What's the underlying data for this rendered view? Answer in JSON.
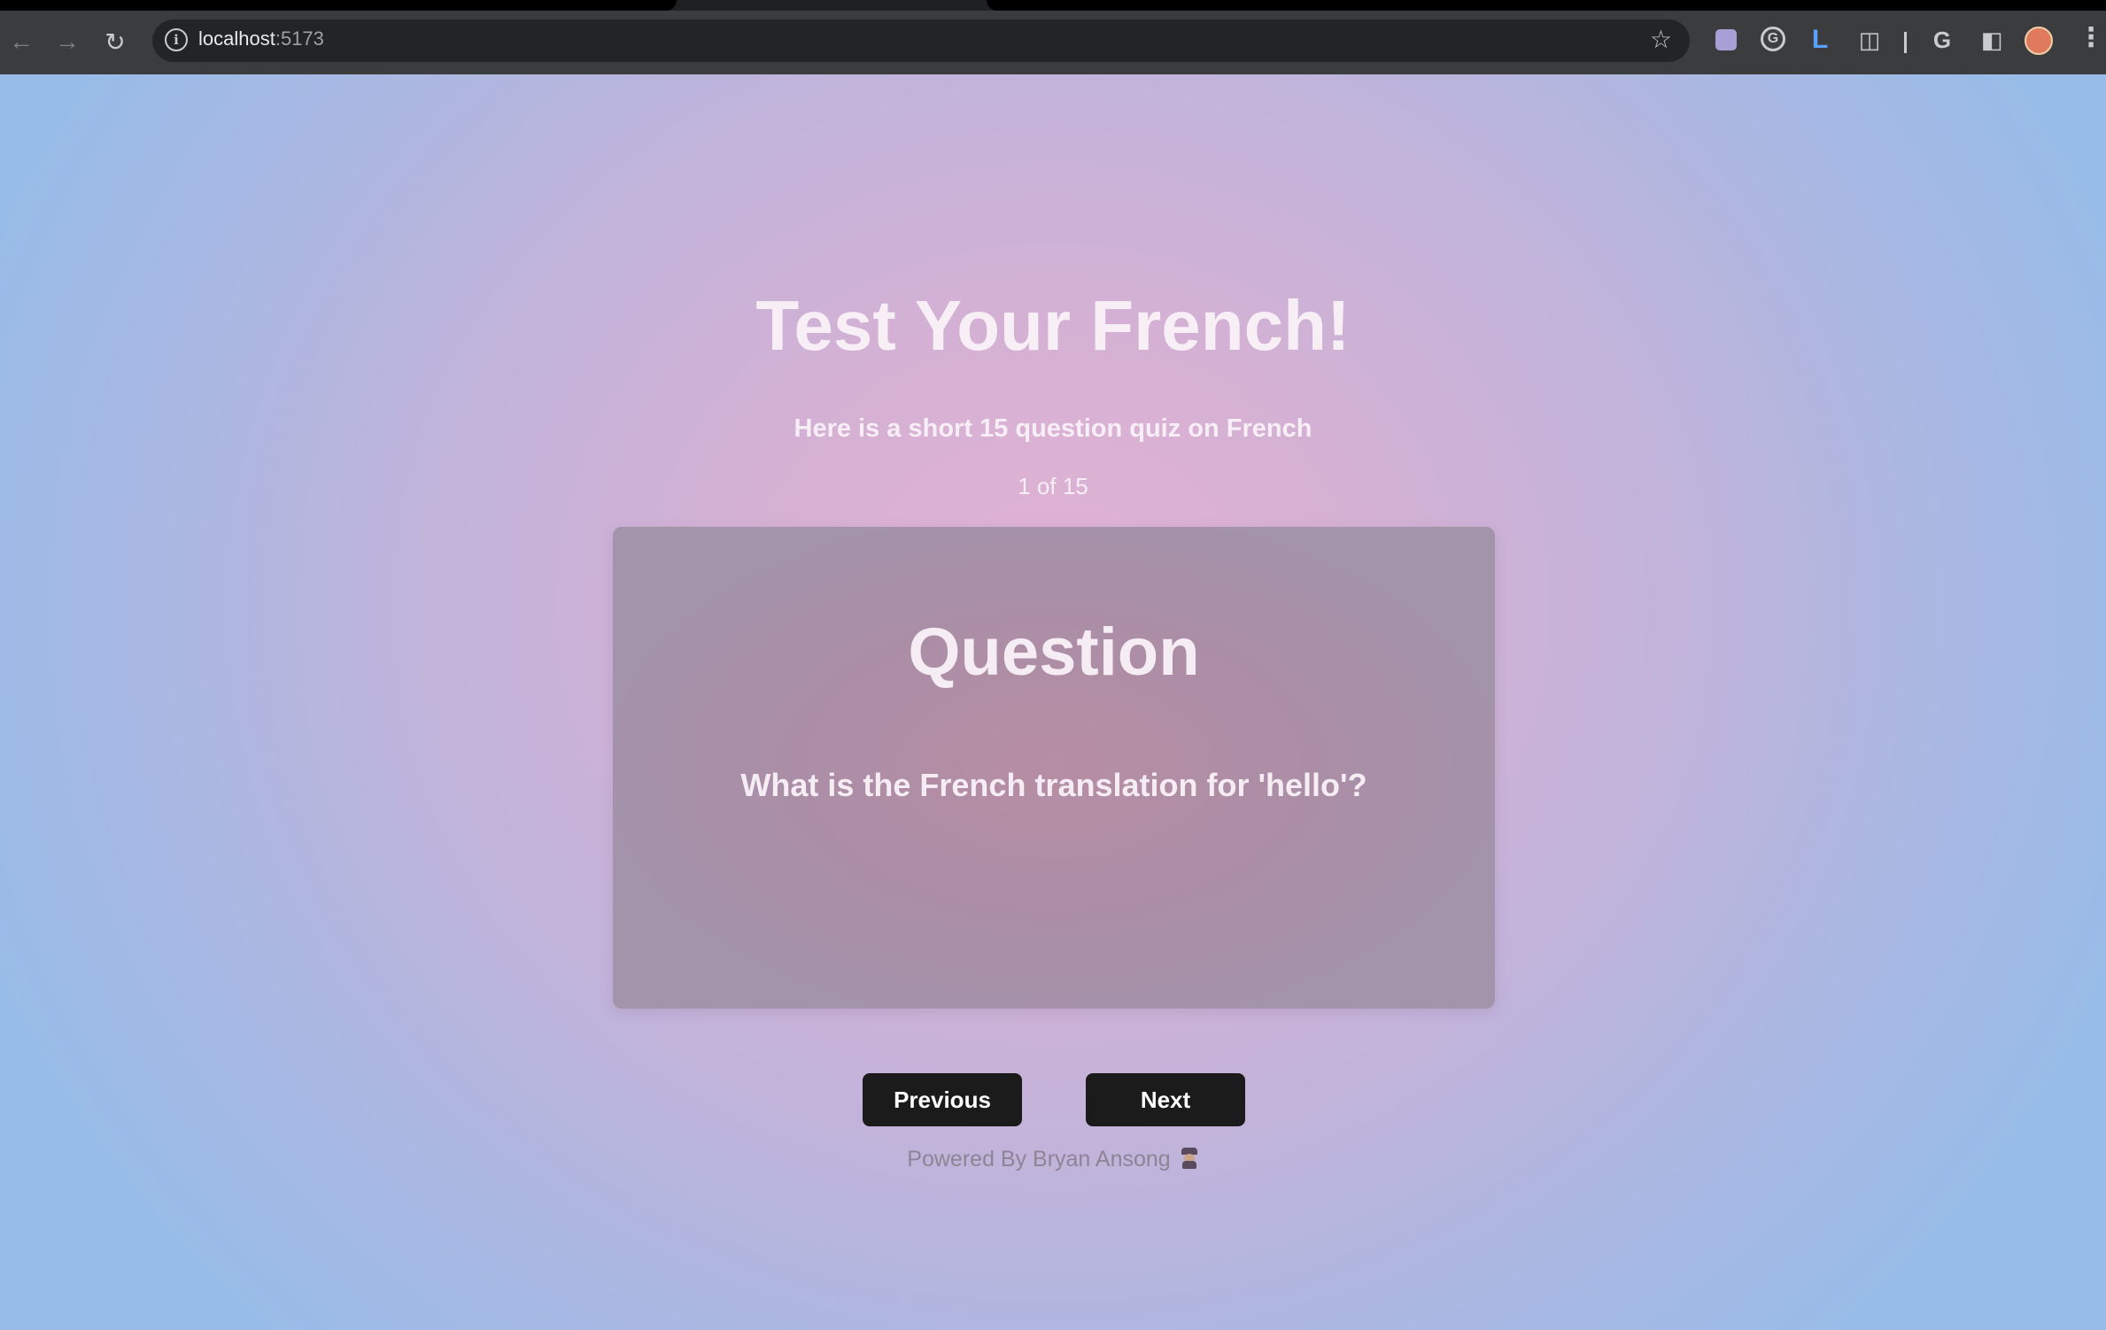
{
  "browser": {
    "url_host": "localhost",
    "url_port": ":5173"
  },
  "page": {
    "title": "Test Your French!",
    "subtitle": "Here is a short 15 question quiz on French",
    "counter": "1 of 15"
  },
  "card": {
    "heading": "Question",
    "question": "What is the French translation for 'hello'?"
  },
  "buttons": {
    "previous": "Previous",
    "next": "Next"
  },
  "footer": {
    "text": "Powered By Bryan Ansong"
  }
}
